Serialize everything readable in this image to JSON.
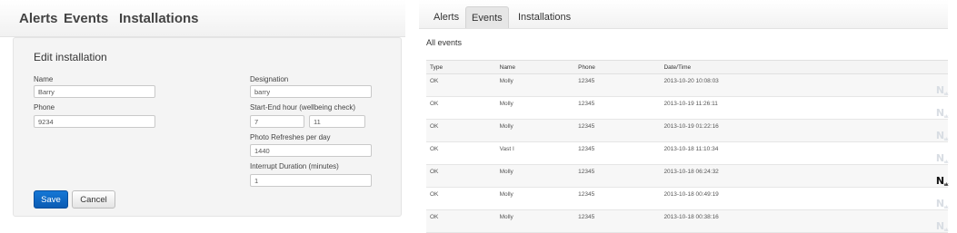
{
  "left": {
    "nav": [
      "Alerts",
      "Events",
      "Installations"
    ],
    "form": {
      "title": "Edit installation",
      "name_label": "Name",
      "name_value": "Barry",
      "phone_label": "Phone",
      "phone_value": "9234",
      "designation_label": "Designation",
      "designation_value": "barry",
      "hours_label": "Start-End hour (wellbeing check)",
      "start_hour": "7",
      "end_hour": "11",
      "photo_label": "Photo Refreshes per day",
      "photo_value": "1440",
      "interrupt_label": "Interrupt Duration (minutes)",
      "interrupt_value": "1",
      "save_label": "Save",
      "cancel_label": "Cancel"
    }
  },
  "right": {
    "tabs": [
      "Alerts",
      "Events",
      "Installations"
    ],
    "active_tab": "Events",
    "section_title": "All events",
    "table": {
      "headers": [
        "Type",
        "Name",
        "Phone",
        "Date/Time",
        ""
      ],
      "rows": [
        {
          "type": "OK",
          "name": "Molly",
          "phone": "12345",
          "datetime": "2013-10-20 10:08:03",
          "status": "N",
          "status_sub": "ok",
          "active": false
        },
        {
          "type": "OK",
          "name": "Molly",
          "phone": "12345",
          "datetime": "2013-10-19 11:26:11",
          "status": "N",
          "status_sub": "ok",
          "active": false
        },
        {
          "type": "OK",
          "name": "Molly",
          "phone": "12345",
          "datetime": "2013-10-19 01:22:16",
          "status": "N",
          "status_sub": "ok",
          "active": false
        },
        {
          "type": "OK",
          "name": "Vast I",
          "phone": "12345",
          "datetime": "2013-10-18 11:10:34",
          "status": "N",
          "status_sub": "ok",
          "active": false
        },
        {
          "type": "OK",
          "name": "Molly",
          "phone": "12345",
          "datetime": "2013-10-18 06:24:32",
          "status": "N",
          "status_sub": "ok",
          "active": true
        },
        {
          "type": "OK",
          "name": "Molly",
          "phone": "12345",
          "datetime": "2013-10-18 00:49:19",
          "status": "N",
          "status_sub": "ok",
          "active": false
        },
        {
          "type": "OK",
          "name": "Molly",
          "phone": "12345",
          "datetime": "2013-10-18 00:38:16",
          "status": "N",
          "status_sub": "ok",
          "active": false
        }
      ]
    }
  },
  "colors": {
    "primary_button": "#0b5cb3",
    "status_icon_active": "#111111",
    "status_icon_inactive": "#d8dde3"
  },
  "icons": {
    "status": "nest-logo-icon"
  }
}
